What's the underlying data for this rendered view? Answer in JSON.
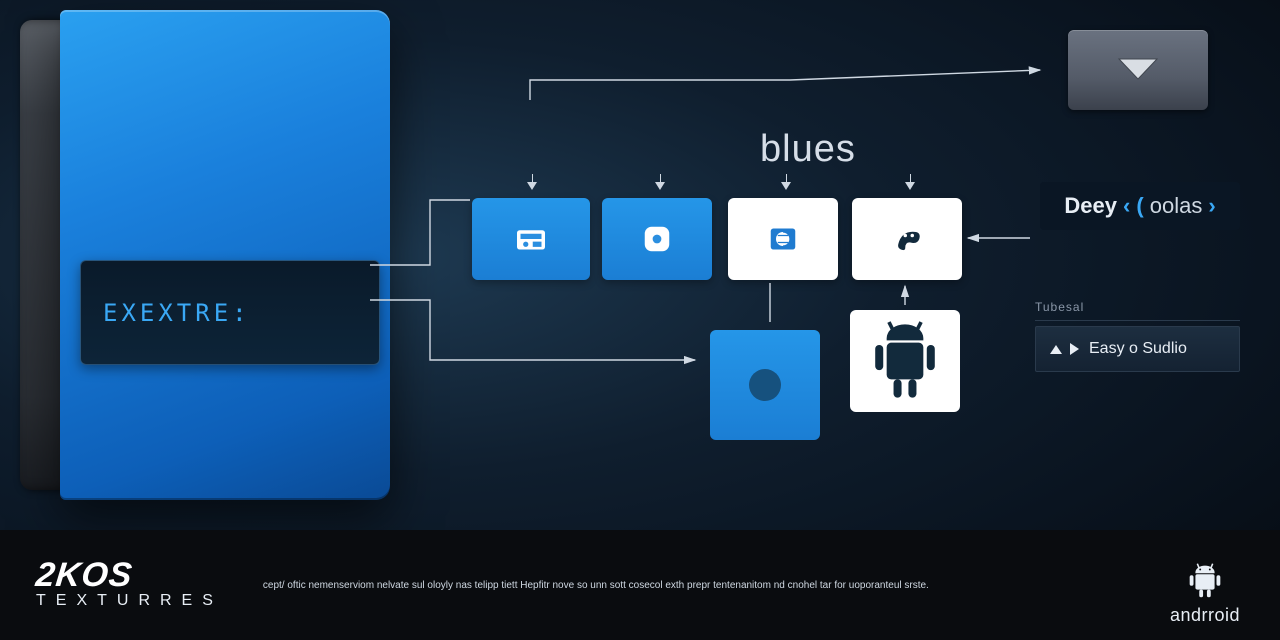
{
  "product_box": {
    "label": "EXEXTRE:"
  },
  "center_heading": "blues",
  "tiles": {
    "t1_icon": "radio-icon",
    "t2_icon": "disc-icon",
    "t3_icon": "globe-icon",
    "t4_icon": "palette-icon",
    "t5_icon": "dot-icon",
    "t6_icon": "android-icon"
  },
  "brand_badge": {
    "seg1": "Deey",
    "seg2": "‹ (",
    "seg3": "oolas",
    "seg4": "›"
  },
  "panel": {
    "label": "Tubesal",
    "button_text": "Easy o Sudlio"
  },
  "footer": {
    "logo": "2KOS",
    "sub": "TEXTURRES",
    "tagline": "cept/ oftic nemenserviom nelvate sul oloyly nas telipp tiett Hepfitr nove so unn sott cosecol exth prepr tentenanitom nd cnohel tar for uoporanteul srste.",
    "droid_text": "andrroid"
  }
}
